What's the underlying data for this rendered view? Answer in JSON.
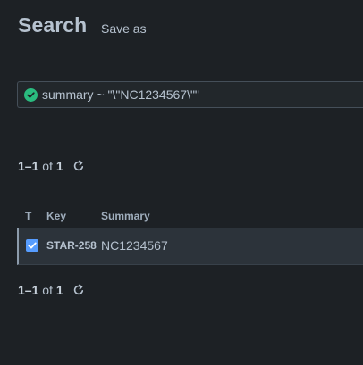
{
  "header": {
    "title": "Search",
    "save_as_label": "Save as"
  },
  "search": {
    "status_icon": "check-circle-icon",
    "status_color": "#2abb7f",
    "query": "summary ~ \"\\\"NC1234567\\\"\""
  },
  "pagination": {
    "range": "1–1",
    "of_label": "of",
    "total": "1",
    "refresh_icon": "refresh-icon"
  },
  "table": {
    "columns": [
      "T",
      "Key",
      "Summary"
    ],
    "rows": [
      {
        "checked": true,
        "key": "STAR-258",
        "summary": "NC1234567"
      }
    ]
  },
  "colors": {
    "background": "#1d2125",
    "text": "#b6c2cf",
    "accent": "#579dff",
    "success": "#2abb7f"
  }
}
